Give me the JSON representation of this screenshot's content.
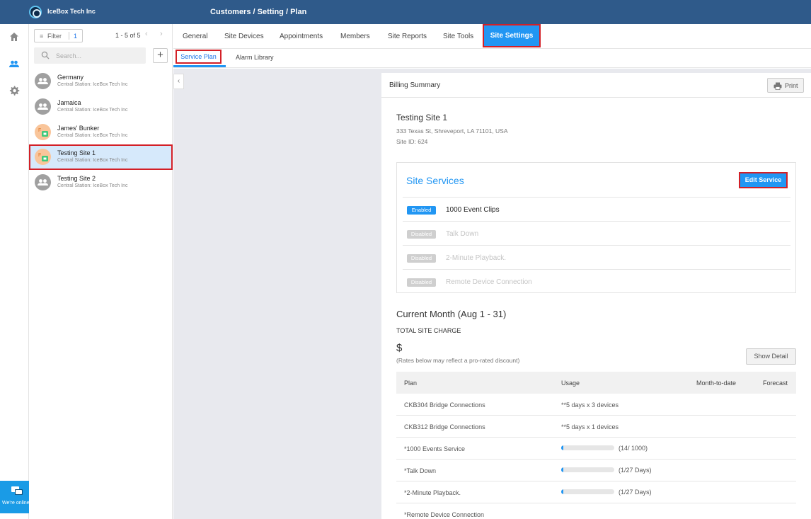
{
  "header": {
    "company": "IceBox Tech Inc",
    "breadcrumb": "Customers / Setting / Plan"
  },
  "rail": {
    "chat_label": "We're online."
  },
  "list": {
    "filter_label": "Filter",
    "filter_count": "1",
    "pager": "1 - 5 of 5",
    "search_placeholder": "Search...",
    "customers": [
      {
        "name": "Germany",
        "sub": "Central Station: IceBox Tech Inc"
      },
      {
        "name": "Jamaica",
        "sub": "Central Station: IceBox Tech Inc"
      },
      {
        "name": "James' Bunker",
        "sub": "Central Station: IceBox Tech Inc"
      },
      {
        "name": "Testing Site 1",
        "sub": "Central Station: IceBox Tech Inc"
      },
      {
        "name": "Testing Site 2",
        "sub": "Central Station: IceBox Tech Inc"
      }
    ]
  },
  "tabs": [
    "General",
    "Site Devices",
    "Appointments",
    "Members",
    "Site Reports",
    "Site Tools",
    "Site Settings"
  ],
  "subtabs": [
    "Service Plan",
    "Alarm Library"
  ],
  "billing": {
    "title": "Billing Summary",
    "print_label": "Print",
    "site_name": "Testing Site 1",
    "site_address": "333 Texas St, Shreveport, LA 71101, USA",
    "site_id": "Site ID: 624",
    "services_title": "Site Services",
    "edit_label": "Edit Service",
    "services": [
      {
        "status": "Enabled",
        "name": "1000 Event Clips"
      },
      {
        "status": "Disabled",
        "name": "Talk Down"
      },
      {
        "status": "Disabled",
        "name": "2-Minute Playback."
      },
      {
        "status": "Disabled",
        "name": "Remote Device Connection"
      }
    ],
    "month_title": "Current Month (Aug 1 - 31)",
    "total_label": "TOTAL SITE CHARGE",
    "total_value": "$",
    "rates_note": "(Rates below may reflect a pro-rated discount)",
    "show_detail_label": "Show Detail",
    "table_headers": [
      "Plan",
      "Usage",
      "Month-to-date",
      "Forecast"
    ],
    "rows": [
      {
        "plan": "CKB304 Bridge Connections",
        "usage": "**5 days x 3 devices"
      },
      {
        "plan": "CKB312 Bridge Connections",
        "usage": "**5 days x 1 devices"
      },
      {
        "plan": "*1000 Events Service",
        "usage_label": "(14/ 1000)",
        "progress": 0.014
      },
      {
        "plan": "*Talk Down",
        "usage_label": "(1/27 Days)",
        "progress": 0.037
      },
      {
        "plan": "*2-Minute Playback.",
        "usage_label": "(1/27 Days)",
        "progress": 0.037
      },
      {
        "plan": "*Remote Device Connection"
      }
    ]
  },
  "colors": {
    "header_bg": "#2f5a8a",
    "accent": "#2196f3",
    "highlight_outline": "#d32027"
  }
}
